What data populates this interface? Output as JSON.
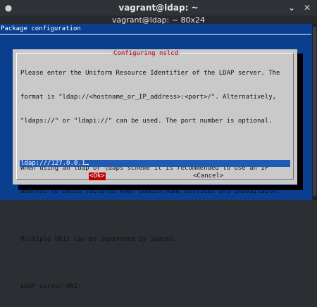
{
  "window": {
    "title": "vagrant@ldap: ~",
    "tab_title": "vagrant@ldap: ~ 80x24",
    "pin_icon": "pin-icon",
    "minimize_icon": "chevron-down-icon",
    "close_icon": "close-icon"
  },
  "terminal": {
    "header_text": "Package configuration",
    "background_color": "#0a3f8f"
  },
  "dialog": {
    "title": "Configuring nslcd",
    "title_color": "#c00000",
    "lines": [
      "Please enter the Uniform Resource Identifier of the LDAP server. The",
      "format is \"ldap://<hostname_or_IP_address>:<port>/\". Alternatively,",
      "\"ldaps://\" or \"ldapi://\" can be used. The port number is optional.",
      "",
      "When using an ldap or ldaps scheme it is recommended to use an IP",
      "address to avoid failures when domain name services are unavailable.",
      "",
      "Multiple URIs can be separated by spaces.",
      "",
      "LDAP server URI:"
    ],
    "input_value": "ldap:///127.0.0.1",
    "ok_label": "<Ok>",
    "cancel_label": "<Cancel>"
  }
}
